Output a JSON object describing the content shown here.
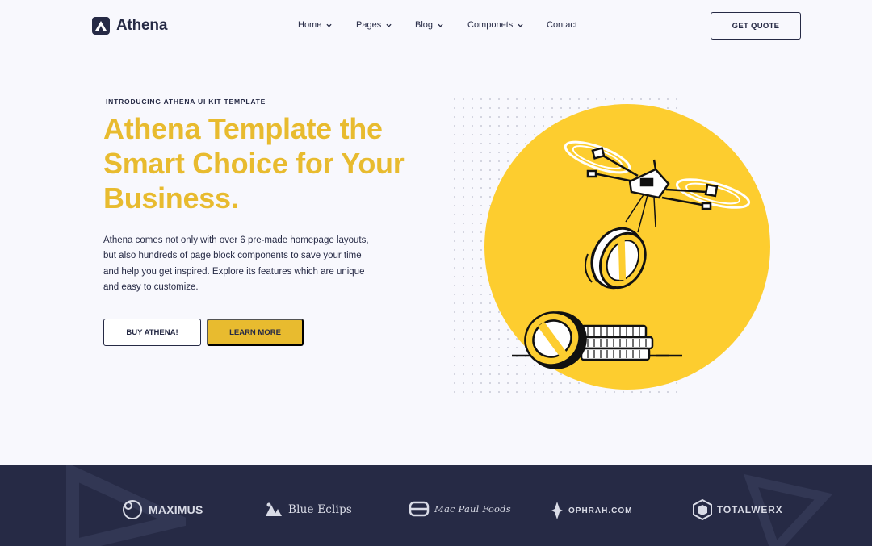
{
  "header": {
    "logo_text": "Athena",
    "nav": [
      {
        "label": "Home"
      },
      {
        "label": "Pages"
      },
      {
        "label": "Blog"
      },
      {
        "label": "Componets"
      },
      {
        "label": "Contact"
      }
    ],
    "cta_label": "GET QUOTE"
  },
  "hero": {
    "eyebrow": "INTRODUCING ATHENA UI KIT TEMPLATE",
    "title": "Athena Template the Smart Choice for Your Business.",
    "description": "Athena comes not only with over 6 pre-made homepage layouts, but also hundreds of page block components to save your time and help you get inspired. Explore its features which are unique and easy to customize.",
    "primary_button": "BUY ATHENA!",
    "secondary_button": "LEARN MORE"
  },
  "brands": [
    {
      "name": "MAXIMUS",
      "icon": "maximus-logo-icon"
    },
    {
      "name": "Blue Eclips",
      "icon": "blue-eclips-logo-icon"
    },
    {
      "name": "Mac Paul Foods",
      "icon": "mac-paul-foods-logo-icon"
    },
    {
      "name": "OPHRAH.COM",
      "icon": "ophrah-logo-icon"
    },
    {
      "name": "TOTALWERX",
      "icon": "totalwerx-logo-icon"
    }
  ],
  "colors": {
    "navy": "#262a45",
    "accent_yellow": "#e8bb2f",
    "circle_yellow": "#fdcd2f",
    "background": "#f8f8fd"
  }
}
